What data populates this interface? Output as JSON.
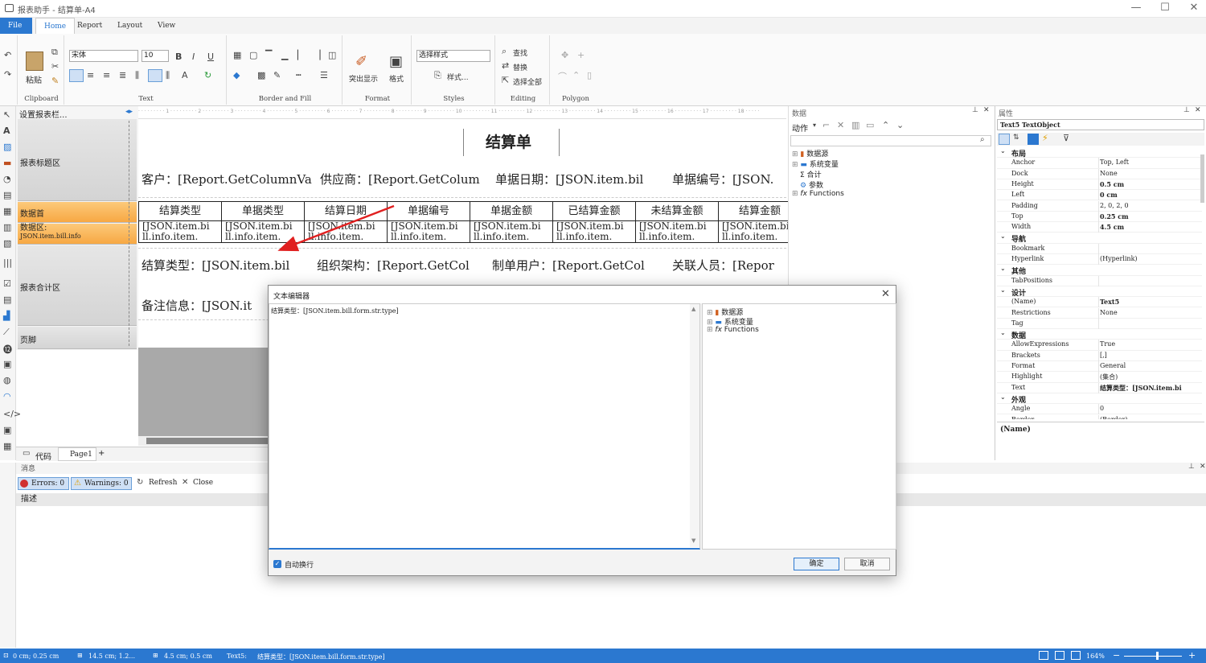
{
  "window": {
    "title": "报表助手 - 结算单-A4",
    "minimize": "—",
    "maximize": "☐",
    "close": "✕"
  },
  "menu": {
    "file": "File",
    "home": "Home",
    "report": "Report",
    "layout": "Layout",
    "view": "View"
  },
  "ribbon": {
    "clipboard": {
      "label": "Clipboard",
      "paste": "粘贴"
    },
    "text": {
      "label": "Text",
      "font": "宋体",
      "size": "10",
      "bold": "B",
      "italic": "I",
      "underline": "U"
    },
    "border": {
      "label": "Border and Fill"
    },
    "format": {
      "label": "Format",
      "highlight": "突出显示",
      "format": "格式"
    },
    "styles": {
      "label": "Styles",
      "select": "选择样式",
      "style": "样式..."
    },
    "editing": {
      "label": "Editing",
      "find": "查找",
      "replace": "替换",
      "select_all": "选择全部"
    },
    "polygon": {
      "label": "Polygon"
    }
  },
  "bands": {
    "setup": "设置报表栏...",
    "title": "报表标题区",
    "header": "数据首",
    "data": "数据区:",
    "data_source": "JSON.item.bill.info",
    "summary": "报表合计区",
    "footer": "页脚"
  },
  "report": {
    "title": "结算单",
    "row1": [
      "客户：[Report.GetColumnVa",
      "供应商：[Report.GetColum",
      "单据日期：[JSON.item.bil",
      "单据编号：[JSON."
    ],
    "headers": [
      "结算类型",
      "单据类型",
      "结算日期",
      "单据编号",
      "单据金额",
      "已结算金额",
      "未结算金额",
      "结算金额"
    ],
    "cell_top": "[JSON.item.bi",
    "cell_bottom": "ll.info.item.",
    "row3": [
      "结算类型：[JSON.item.bil",
      "组织架构：[Report.GetCol",
      "制单用户：[Report.GetCol",
      "关联人员：[Repor"
    ],
    "row4": "备注信息：[JSON.it"
  },
  "tabs": {
    "code": "代码",
    "page": "Page1",
    "add": "+"
  },
  "messages": {
    "title": "消息",
    "errors": "Errors: 0",
    "warnings": "Warnings: 0",
    "refresh": "Refresh",
    "close": "Close",
    "col": "描述"
  },
  "data_panel": {
    "title": "数据",
    "action": "动作",
    "tree": [
      "数据源",
      "系统变量",
      "合计",
      "参数",
      "Functions"
    ]
  },
  "properties": {
    "title": "属性",
    "object": "Text5 TextObject",
    "rows": [
      {
        "cat": "布局"
      },
      {
        "k": "Anchor",
        "v": "Top, Left"
      },
      {
        "k": "Dock",
        "v": "None"
      },
      {
        "k": "Height",
        "v": "0.5 cm"
      },
      {
        "k": "Left",
        "v": "0 cm"
      },
      {
        "k": "Padding",
        "v": "2, 0, 2, 0"
      },
      {
        "k": "Top",
        "v": "0.25 cm"
      },
      {
        "k": "Width",
        "v": "4.5 cm"
      },
      {
        "cat": "导航"
      },
      {
        "k": "Bookmark",
        "v": ""
      },
      {
        "k": "Hyperlink",
        "v": "(Hyperlink)"
      },
      {
        "cat": "其他"
      },
      {
        "k": "TabPositions",
        "v": ""
      },
      {
        "cat": "设计"
      },
      {
        "k": "(Name)",
        "v": "Text5"
      },
      {
        "k": "Restrictions",
        "v": "None"
      },
      {
        "k": "Tag",
        "v": ""
      },
      {
        "cat": "数据"
      },
      {
        "k": "AllowExpressions",
        "v": "True"
      },
      {
        "k": "Brackets",
        "v": "[,]"
      },
      {
        "k": "Format",
        "v": "General"
      },
      {
        "k": "Highlight",
        "v": "(集合)"
      },
      {
        "k": "Text",
        "v": "结算类型：[JSON.item.bi"
      },
      {
        "cat": "外观"
      },
      {
        "k": "Angle",
        "v": "0"
      },
      {
        "k": "Border",
        "v": "(Border)"
      }
    ],
    "desc": "(Name)"
  },
  "dialog": {
    "title": "文本编辑器",
    "content": "结算类型：[JSON.item.bill.form.str.type]",
    "tree": [
      "数据源",
      "系统变量",
      "Functions"
    ],
    "wrap": "自动换行",
    "ok": "确定",
    "cancel": "取消"
  },
  "status": {
    "pos": "0 cm; 0.25 cm",
    "size1": "14.5 cm; 1.2...",
    "size2": "4.5 cm; 0.5 cm",
    "obj": "Text5:",
    "text": "结算类型：[JSON.item.bill.form.str.type]",
    "zoom": "164%"
  }
}
